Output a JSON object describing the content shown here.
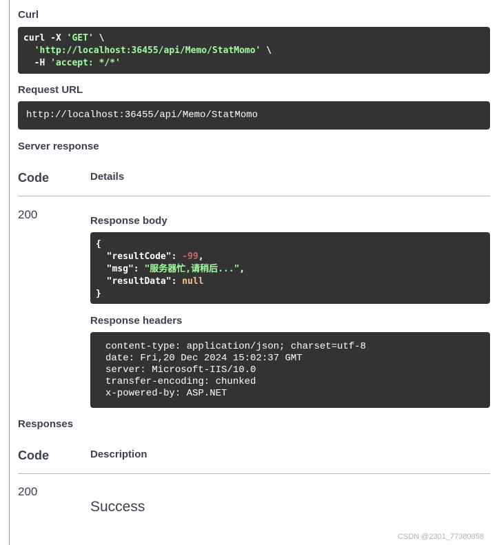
{
  "curl": {
    "title": "Curl",
    "line1_cmd": "curl -X ",
    "line1_method": "'GET'",
    "line1_tail": " \\",
    "line2_indent": "  ",
    "line2_url": "'http://localhost:36455/api/Memo/StatMomo'",
    "line2_tail": " \\",
    "line3_flag": "  -H ",
    "line3_header": "'accept: */*'"
  },
  "request_url": {
    "title": "Request URL",
    "value": "http://localhost:36455/api/Memo/StatMomo"
  },
  "server_response": {
    "title": "Server response",
    "col_code": "Code",
    "col_details": "Details",
    "status_code": "200",
    "response_body_title": "Response body",
    "body": {
      "open": "{",
      "result_code_key": "\"resultCode\"",
      "result_code_value": "-99",
      "msg_key": "\"msg\"",
      "msg_value": "\"服务器忙,请稍后...\"",
      "result_data_key": "\"resultData\"",
      "result_data_value": "null",
      "close": "}"
    },
    "response_headers_title": "Response headers",
    "headers": [
      "content-type: application/json; charset=utf-8",
      "date: Fri,20 Dec 2024 15:02:37 GMT",
      "server: Microsoft-IIS/10.0",
      "transfer-encoding: chunked",
      "x-powered-by: ASP.NET"
    ]
  },
  "responses": {
    "title": "Responses",
    "col_code": "Code",
    "col_description": "Description",
    "status_code": "200",
    "description": "Success"
  },
  "watermark": "CSDN @2301_77380858",
  "colors": {
    "panel_border": "#61affe",
    "code_bg": "#333333",
    "string": "#a2fca2",
    "number": "#d36363",
    "literal": "#fcc28c",
    "text": "#3b4151"
  }
}
